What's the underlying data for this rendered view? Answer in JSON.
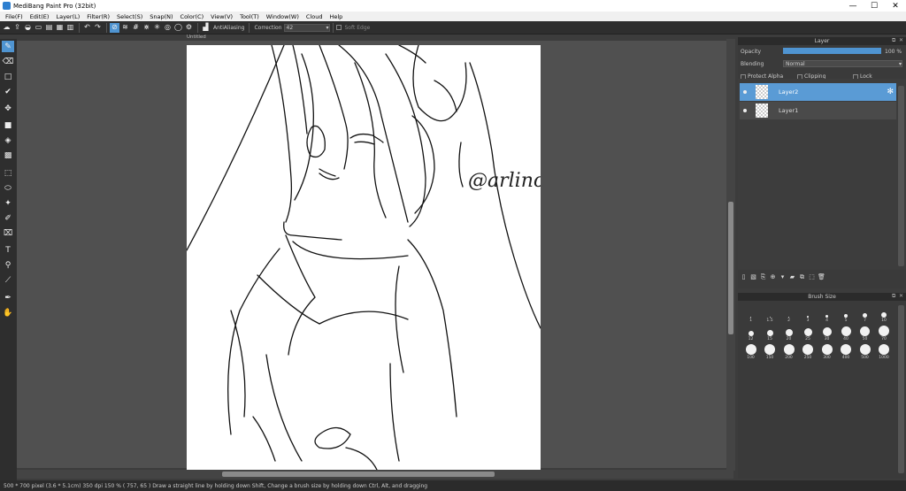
{
  "app": {
    "title": "MediBang Paint Pro (32bit)"
  },
  "window_controls": {
    "minimize": "—",
    "maximize": "☐",
    "close": "✕"
  },
  "menu": [
    "File(F)",
    "Edit(E)",
    "Layer(L)",
    "Filter(R)",
    "Select(S)",
    "Snap(N)",
    "Color(C)",
    "View(V)",
    "Tool(T)",
    "Window(W)",
    "Cloud",
    "Help"
  ],
  "toolbar": {
    "antialiasing_label": "AntiAliasing",
    "correction_label": "Correction",
    "correction_value": "42",
    "soft_edge_label": "Soft Edge"
  },
  "document": {
    "tab_title": "Untitled"
  },
  "canvas": {
    "signature_text": "@arlino"
  },
  "layer_panel": {
    "title": "Layer",
    "opacity_label": "Opacity",
    "opacity_value": "100 %",
    "opacity_fraction": 1.0,
    "blending_label": "Blending",
    "blending_value": "Normal",
    "protect_alpha_label": "Protect Alpha",
    "clipping_label": "Clipping",
    "lock_label": "Lock",
    "layers": [
      {
        "name": "Layer2",
        "selected": true
      },
      {
        "name": "Layer1",
        "selected": false
      }
    ]
  },
  "brush_panel": {
    "title": "Brush Size",
    "sizes": [
      "1",
      "1.5",
      "2",
      "3",
      "4",
      "5",
      "7",
      "10",
      "12",
      "15",
      "20",
      "25",
      "30",
      "40",
      "50",
      "70",
      "100",
      "150",
      "200",
      "250",
      "300",
      "400",
      "500",
      "1000"
    ]
  },
  "status": {
    "text": "500 * 700 pixel   (3.6 * 5.1cm)   350 dpi   150 %   ( 757, 65 )   Draw a straight line by holding down Shift, Change a brush size by holding down Ctrl, Alt, and dragging"
  },
  "colors": {
    "accent": "#4f94d1",
    "selected_layer": "#5a9bd5",
    "panel_bg": "#3a3a3a",
    "workspace": "#505050"
  }
}
